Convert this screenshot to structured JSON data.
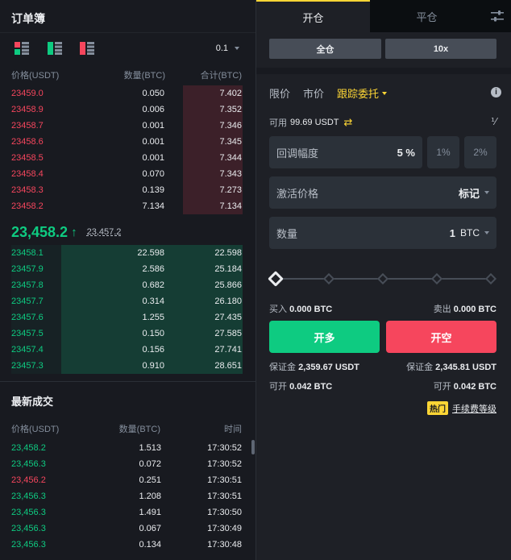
{
  "orderbook": {
    "title": "订单簿",
    "precision": "0.1",
    "headers": {
      "price": "价格(USDT)",
      "qty": "数量(BTC)",
      "total": "合计(BTC)"
    },
    "asks": [
      {
        "price": "23459.0",
        "qty": "0.050",
        "total": "7.402",
        "depth": 0.26
      },
      {
        "price": "23458.9",
        "qty": "0.006",
        "total": "7.352",
        "depth": 0.26
      },
      {
        "price": "23458.7",
        "qty": "0.001",
        "total": "7.346",
        "depth": 0.26
      },
      {
        "price": "23458.6",
        "qty": "0.001",
        "total": "7.345",
        "depth": 0.26
      },
      {
        "price": "23458.5",
        "qty": "0.001",
        "total": "7.344",
        "depth": 0.26
      },
      {
        "price": "23458.4",
        "qty": "0.070",
        "total": "7.343",
        "depth": 0.26
      },
      {
        "price": "23458.3",
        "qty": "0.139",
        "total": "7.273",
        "depth": 0.26
      },
      {
        "price": "23458.2",
        "qty": "7.134",
        "total": "7.134",
        "depth": 0.26
      }
    ],
    "last_price": "23,458.2",
    "last_arrow": "↑",
    "mark_price": "23,457.2",
    "bids": [
      {
        "price": "23458.1",
        "qty": "22.598",
        "total": "22.598",
        "depth": 0.79
      },
      {
        "price": "23457.9",
        "qty": "2.586",
        "total": "25.184",
        "depth": 0.79
      },
      {
        "price": "23457.8",
        "qty": "0.682",
        "total": "25.866",
        "depth": 0.79
      },
      {
        "price": "23457.7",
        "qty": "0.314",
        "total": "26.180",
        "depth": 0.79
      },
      {
        "price": "23457.6",
        "qty": "1.255",
        "total": "27.435",
        "depth": 0.79
      },
      {
        "price": "23457.5",
        "qty": "0.150",
        "total": "27.585",
        "depth": 0.79
      },
      {
        "price": "23457.4",
        "qty": "0.156",
        "total": "27.741",
        "depth": 0.79
      },
      {
        "price": "23457.3",
        "qty": "0.910",
        "total": "28.651",
        "depth": 0.79
      }
    ]
  },
  "trades": {
    "title": "最新成交",
    "headers": {
      "price": "价格(USDT)",
      "qty": "数量(BTC)",
      "time": "时间"
    },
    "rows": [
      {
        "price": "23,458.2",
        "qty": "1.513",
        "time": "17:30:52",
        "side": "up"
      },
      {
        "price": "23,456.3",
        "qty": "0.072",
        "time": "17:30:52",
        "side": "up"
      },
      {
        "price": "23,456.2",
        "qty": "0.251",
        "time": "17:30:51",
        "side": "down"
      },
      {
        "price": "23,456.3",
        "qty": "1.208",
        "time": "17:30:51",
        "side": "up"
      },
      {
        "price": "23,456.3",
        "qty": "1.491",
        "time": "17:30:50",
        "side": "up"
      },
      {
        "price": "23,456.3",
        "qty": "0.067",
        "time": "17:30:49",
        "side": "up"
      },
      {
        "price": "23,456.3",
        "qty": "0.134",
        "time": "17:30:48",
        "side": "up"
      }
    ]
  },
  "trade_panel": {
    "tabs": {
      "open": "开仓",
      "close": "平仓"
    },
    "margin_mode": "全仓",
    "leverage": "10x",
    "order_types": {
      "limit": "限价",
      "market": "市价",
      "trailing": "跟踪委托"
    },
    "available_label": "可用",
    "available_value": "99.69 USDT",
    "callback_label": "回调幅度",
    "callback_value": "5 %",
    "callback_opts": [
      "1%",
      "2%"
    ],
    "activate_label": "激活价格",
    "activate_value": "标记",
    "qty_label": "数量",
    "qty_value": "1",
    "qty_unit": "BTC",
    "slider_level": 0,
    "buy_label": "买入",
    "buy_value": "0.000 BTC",
    "sell_label": "卖出",
    "sell_value": "0.000 BTC",
    "long_button": "开多",
    "short_button": "开空",
    "margin_label": "保证金",
    "margin_long": "2,359.67 USDT",
    "margin_short": "2,345.81 USDT",
    "can_open_label": "可开",
    "can_open_long": "0.042 BTC",
    "can_open_short": "0.042 BTC",
    "hot_badge": "热门",
    "fee_link": "手续费等级"
  },
  "colors": {
    "buy": "#0ecb81",
    "sell": "#f6465d",
    "accent": "#fcd535"
  }
}
